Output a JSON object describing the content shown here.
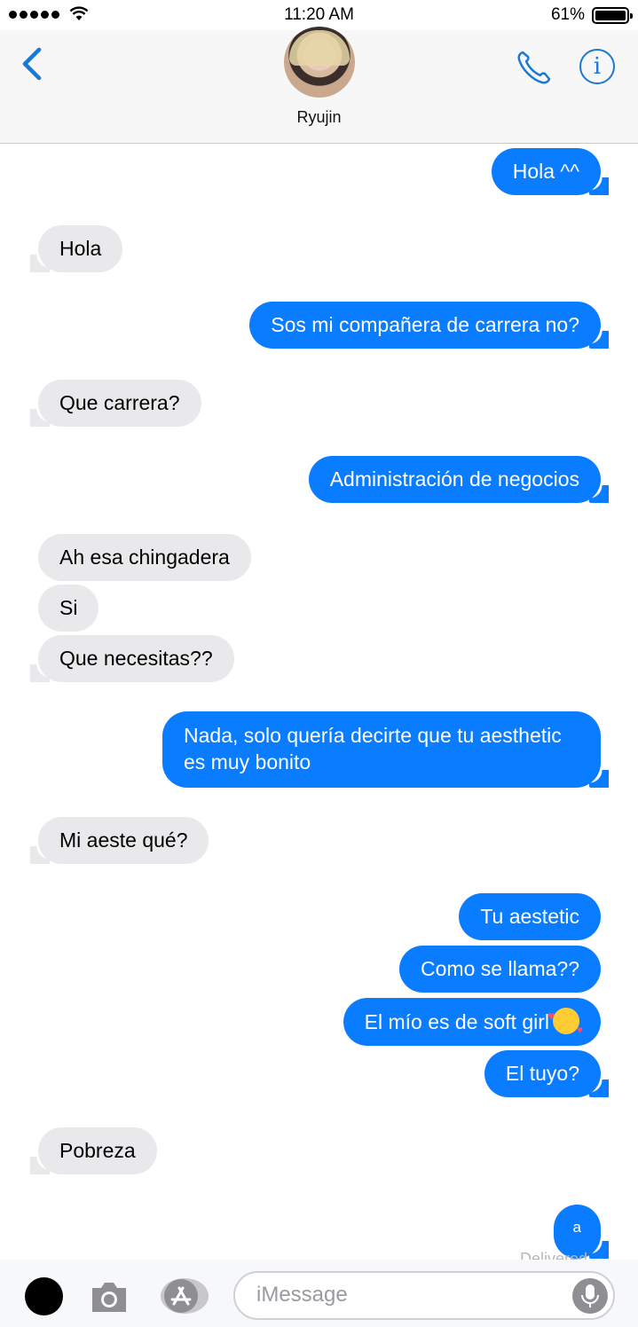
{
  "status_bar": {
    "time": "11:20 AM",
    "battery": "61%"
  },
  "header": {
    "contact_name": "Ryujin",
    "back_icon": "chevron-left-icon",
    "call_icon": "phone-icon",
    "info_icon": "info-icon",
    "info_label": "i"
  },
  "messages": [
    {
      "from": "me",
      "text": "Hola ^^"
    },
    {
      "from": "them",
      "text": "Hola"
    },
    {
      "from": "me",
      "text": "Sos mi compañera de carrera no?"
    },
    {
      "from": "them",
      "text": "Que carrera?"
    },
    {
      "from": "me",
      "text": "Administración de negocios"
    },
    {
      "from": "them",
      "text": "Ah esa chingadera"
    },
    {
      "from": "them",
      "text": "Si"
    },
    {
      "from": "them",
      "text": "Que necesitas??"
    },
    {
      "from": "me",
      "text": "Nada, solo quería decirte que tu aesthetic es muy bonito"
    },
    {
      "from": "them",
      "text": "Mi aeste qué?"
    },
    {
      "from": "me",
      "text": "Tu aestetic"
    },
    {
      "from": "me",
      "text": "Como se llama??"
    },
    {
      "from": "me",
      "text": "El mío es de soft girl",
      "emoji": "smiling-face-with-hearts"
    },
    {
      "from": "me",
      "text": "El tuyo?"
    },
    {
      "from": "them",
      "text": "Pobreza"
    },
    {
      "from": "me",
      "text": "a"
    }
  ],
  "footer_partial": "Delivered",
  "composer": {
    "placeholder": "iMessage",
    "value": "",
    "icons": [
      "digital-touch-icon",
      "camera-icon",
      "app-store-icon",
      "microphone-icon"
    ]
  },
  "colors": {
    "sent_bubble": "#0a7cff",
    "received_bubble": "#e9e9eb",
    "accent": "#1a78d6"
  }
}
